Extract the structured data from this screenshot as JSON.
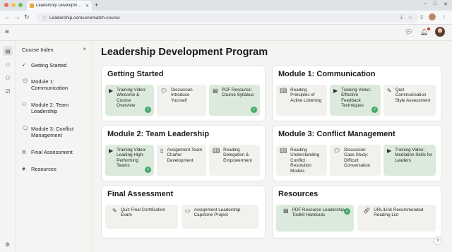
{
  "browser": {
    "tab_title": "Leadership Development Pro",
    "new_tab": "+",
    "url": "Leadership.comsonematch-course",
    "win_min": "–",
    "win_max": "□",
    "win_close": "✕"
  },
  "sidebar": {
    "title": "Course Index",
    "close": "×",
    "items": [
      {
        "label": "Getting Started",
        "icon": "rocket-icon"
      },
      {
        "label": "Module 1: Communication",
        "icon": "chat-icon"
      },
      {
        "label": "Module 2: Team Leadership",
        "icon": "team-icon"
      },
      {
        "label": "Module 3: Conflict Management",
        "icon": "chat-conflict-icon"
      },
      {
        "label": "Final Assessment",
        "icon": "check-circle-icon"
      },
      {
        "label": "Resources",
        "icon": "layers-icon"
      }
    ]
  },
  "main": {
    "title": "Leadership Development Program",
    "cards": {
      "getting_started": {
        "title": "Getting Started",
        "items": [
          {
            "text": "Training Video: Welcome & Course Overview",
            "completed": true
          },
          {
            "text": "Discussion Introduce Yourself",
            "completed": false
          },
          {
            "text": "PDF Resource: Course Syllabus",
            "completed": true
          }
        ]
      },
      "module1": {
        "title": "Module 1: Communication",
        "items": [
          {
            "text": "Reading Principles of Active Listening",
            "completed": false
          },
          {
            "text": "Training Video: Effective Feedback Techniques",
            "completed": true
          },
          {
            "text": "Quiz Communication Style Assessment",
            "completed": false
          }
        ]
      },
      "module2": {
        "title": "Module 2: Team Leadership",
        "items": [
          {
            "text": "Training Video: Leading High-Performing Teams",
            "completed": true
          },
          {
            "text": "Assignment Team Charter Development",
            "completed": false
          },
          {
            "text": "Reading Delegation & Empowerment",
            "completed": false
          }
        ]
      },
      "module3": {
        "title": "Module 3: Conflict Management",
        "items": [
          {
            "text": "Reading Understanding Conflict Resolution Models",
            "completed": false
          },
          {
            "text": "Discussion Case Study: Difficult Conversation",
            "completed": false
          },
          {
            "text": "Training Video: Mediation Skills for Leaders",
            "completed": false
          }
        ]
      },
      "final": {
        "title": "Final Assessment",
        "items": [
          {
            "text": "Quiz Final Certification Exam",
            "completed": false
          },
          {
            "text": "Assignment Leadership Capstone Project",
            "completed": false
          }
        ]
      },
      "resources": {
        "title": "Resources",
        "items": [
          {
            "text": "PDF Resource Leadership Toolkit Handouts",
            "completed": true
          },
          {
            "text": "URL/Link Recommended Reading List",
            "completed": false
          }
        ]
      }
    }
  },
  "help": "?",
  "colors": {
    "completed_bg": "#dbeadc",
    "check": "#46a86b",
    "item_bg": "#f2f1ee"
  }
}
